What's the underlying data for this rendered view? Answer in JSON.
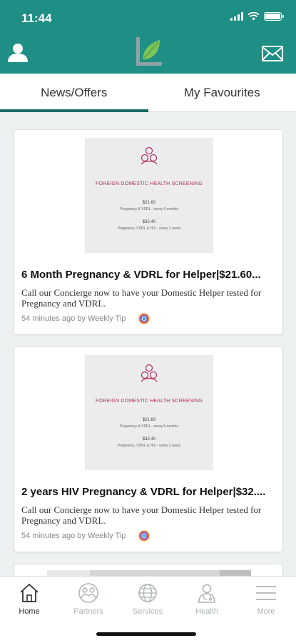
{
  "status": {
    "time": "11:44"
  },
  "colors": {
    "brand": "#1f8e84",
    "tab_indicator": "#1a6a63",
    "poster_accent": "#b03060"
  },
  "header": {
    "profile_icon": "person-icon",
    "logo_icon": "leaf-logo-icon",
    "mail_icon": "envelope-icon"
  },
  "tabs": [
    {
      "label": "News/Offers",
      "active": true
    },
    {
      "label": "My Favourites",
      "active": false
    }
  ],
  "posts": [
    {
      "poster": {
        "heading": "FOREIGN DOMESTIC HEALTH SCREENING",
        "price1": "$21.60",
        "desc1": "Pregnancy & VDRL - every 6 months",
        "price2": "$32.40",
        "desc2": "Pregnancy, VDRL & HIV - every 2 years"
      },
      "title": "6 Month Pregnancy & VDRL for Helper|$21.60...",
      "description": "Call our Concierge now to have your Domestic Helper tested for Pregnancy and VDRL.",
      "meta": "54 minutes ago by Weekly Tip"
    },
    {
      "poster": {
        "heading": "FOREIGN DOMESTIC HEALTH SCREENING",
        "price1": "$21.60",
        "desc1": "Pregnancy & VDRL - every 6 months",
        "price2": "$32.40",
        "desc2": "Pregnancy, VDRL & HIV - every 2 years"
      },
      "title": "2 years HIV Pregnancy & VDRL for Helper|$32....",
      "description": "Call our Concierge now to have your Domestic Helper tested for Pregnancy and VDRL.",
      "meta": "54 minutes ago by Weekly Tip"
    }
  ],
  "bottom_nav": [
    {
      "label": "Home",
      "icon": "home-icon",
      "active": true
    },
    {
      "label": "Partners",
      "icon": "partners-icon",
      "active": false
    },
    {
      "label": "Services",
      "icon": "globe-icon",
      "active": false
    },
    {
      "label": "Health",
      "icon": "doctor-icon",
      "active": false
    },
    {
      "label": "More",
      "icon": "hamburger-menu-icon",
      "active": false
    }
  ]
}
